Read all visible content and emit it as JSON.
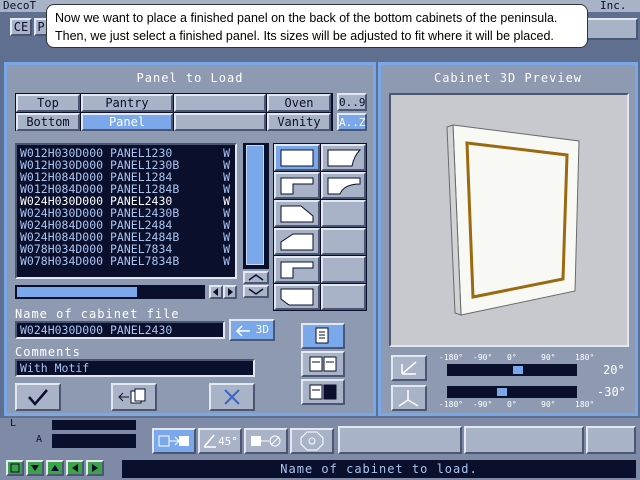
{
  "app": {
    "title_left": "DecoT",
    "title_right": "Inc.",
    "ce_label": "CE",
    "p_label": "P"
  },
  "tooltip": {
    "line1": "Now we want to place a finished panel on the back of the bottom cabinets of the peninsula.",
    "line2": "Then, we just select a finished panel. Its sizes will be adjusted to fit where it will be placed."
  },
  "panel_to_load": {
    "title": "Panel to Load",
    "categories": [
      "Top",
      "Pantry",
      "",
      "Oven",
      "Bottom",
      "Panel",
      "",
      "Vanity"
    ],
    "sort_buttons": [
      "0..9",
      "A..Z"
    ],
    "files": [
      {
        "name": "W012H030D000 PANEL1230",
        "tag": "W"
      },
      {
        "name": "W012H030D000 PANEL1230B",
        "tag": "W"
      },
      {
        "name": "W012H084D000 PANEL1284",
        "tag": "W"
      },
      {
        "name": "W012H084D000 PANEL1284B",
        "tag": "W"
      },
      {
        "name": "W024H030D000 PANEL2430",
        "tag": "W"
      },
      {
        "name": "W024H030D000 PANEL2430B",
        "tag": "W"
      },
      {
        "name": "W024H084D000 PANEL2484",
        "tag": "W"
      },
      {
        "name": "W024H084D000 PANEL2484B",
        "tag": "W"
      },
      {
        "name": "W078H034D000 PANEL7834",
        "tag": "W"
      },
      {
        "name": "W078H034D000 PANEL7834B",
        "tag": "W"
      }
    ],
    "name_label": "Name of cabinet file",
    "name_value": "W024H030D000 PANEL2430",
    "to3d_label": "3D",
    "comments_label": "Comments",
    "comments_value": "With Motif"
  },
  "preview": {
    "title": "Cabinet 3D Preview",
    "h_ticks": [
      "-180°",
      "-90°",
      "0°",
      "90°",
      "180°"
    ],
    "v_ticks": [
      "-180°",
      "-90°",
      "0°",
      "90°",
      "180°"
    ],
    "h_value": "20°",
    "v_value": "-30°",
    "h_slider_fraction": 0.55,
    "v_slider_fraction": 0.42,
    "frame_color": "#9a6a10"
  },
  "bottom": {
    "angle_label": "45°",
    "status": "Name of cabinet to load."
  }
}
